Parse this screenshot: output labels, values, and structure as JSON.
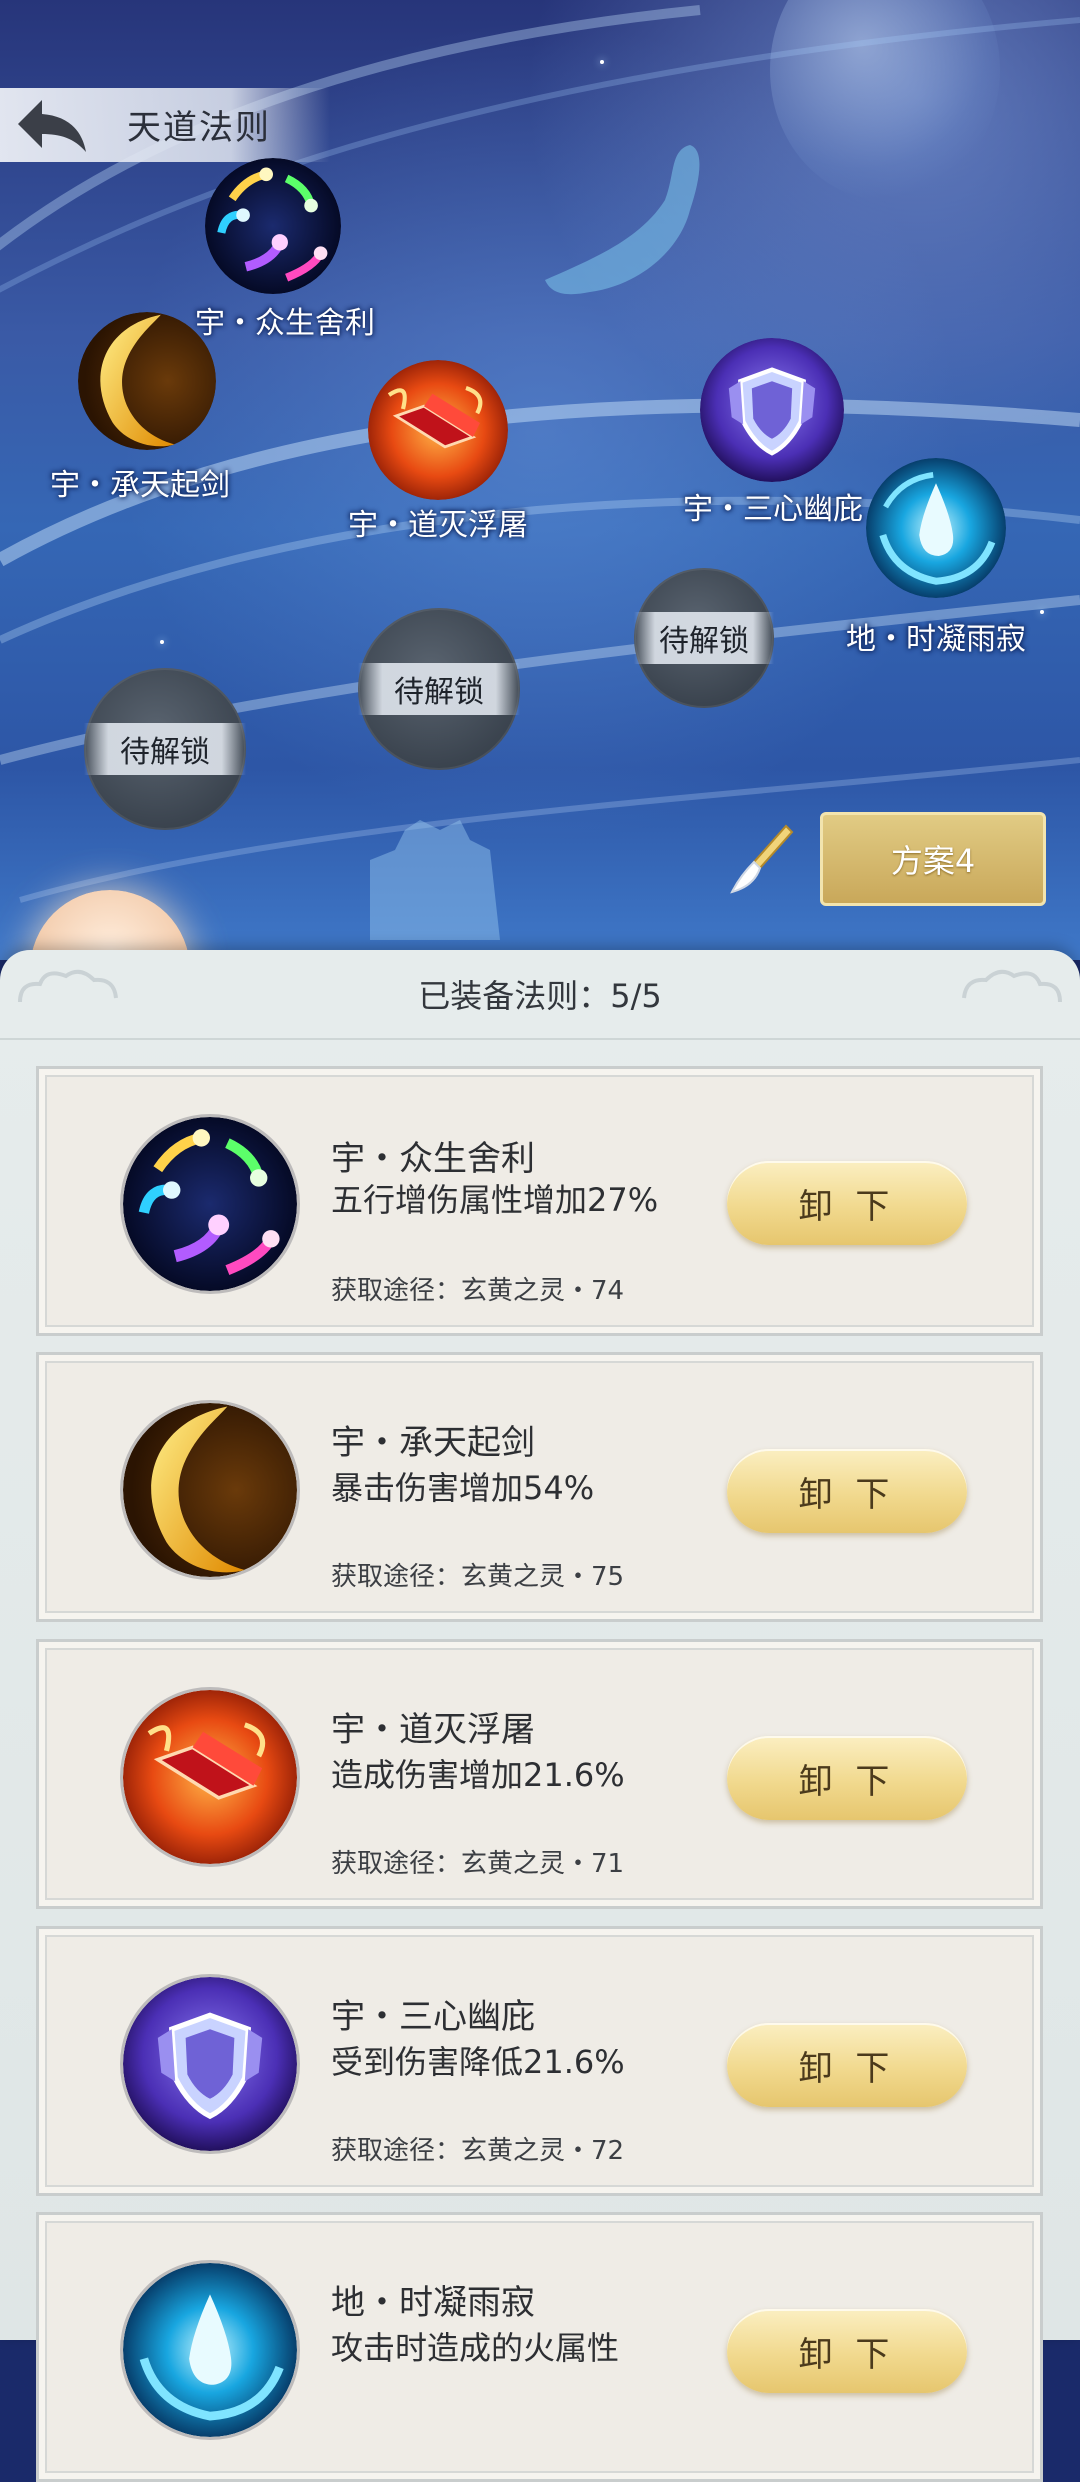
{
  "header": {
    "title": "天道法则"
  },
  "scene": {
    "nodes": [
      {
        "label": "宇・众生舍利",
        "icon": "comet-orbs-icon"
      },
      {
        "label": "宇・承天起剑",
        "icon": "golden-crescent-icon"
      },
      {
        "label": "宇・道灭浮屠",
        "icon": "red-crystal-icon"
      },
      {
        "label": "宇・三心幽庇",
        "icon": "violet-shield-icon"
      },
      {
        "label": "地・时凝雨寂",
        "icon": "water-drop-swirl-icon"
      }
    ],
    "locked_label": "待解锁",
    "plan_button": "方案4"
  },
  "panel": {
    "equipped_text": "已装备法则：5/5",
    "unequip_label": "卸 下",
    "cards": [
      {
        "name": "宇・众生舍利",
        "effect": "五行增伤属性增加27%",
        "source": "获取途径：玄黄之灵・74",
        "icon": "comet-orbs-icon"
      },
      {
        "name": "宇・承天起剑",
        "effect": "暴击伤害增加54%",
        "source": "获取途径：玄黄之灵・75",
        "icon": "golden-crescent-icon"
      },
      {
        "name": "宇・道灭浮屠",
        "effect": "造成伤害增加21.6%",
        "source": "获取途径：玄黄之灵・71",
        "icon": "red-crystal-icon"
      },
      {
        "name": "宇・三心幽庇",
        "effect": "受到伤害降低21.6%",
        "source": "获取途径：玄黄之灵・72",
        "icon": "violet-shield-icon"
      },
      {
        "name": "地・时凝雨寂",
        "effect": "攻击时造成的火属性",
        "icon": "water-drop-swirl-icon"
      }
    ]
  }
}
